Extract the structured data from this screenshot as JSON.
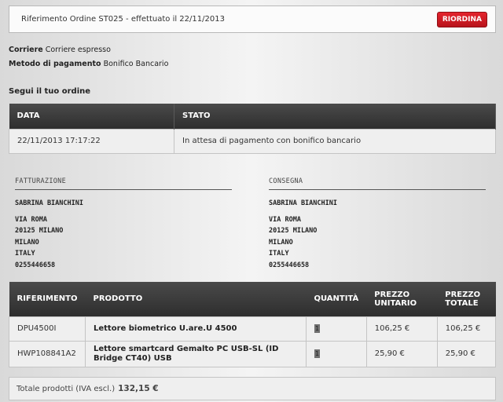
{
  "header": {
    "order_ref": "Riferimento Ordine ST025 - effettuato il 22/11/2013",
    "reorder_label": "RIORDINA",
    "accent_color": "#d71a22"
  },
  "info": {
    "carrier_label": "Corriere",
    "carrier_value": "Corriere espresso",
    "payment_label": "Metodo di pagamento",
    "payment_value": "Bonifico Bancario"
  },
  "tracking": {
    "title": "Segui il tuo ordine",
    "columns": [
      "DATA",
      "STATO"
    ],
    "rows": [
      {
        "date": "22/11/2013 17:17:22",
        "status": "In attesa di pagamento con bonifico bancario"
      }
    ]
  },
  "billing": {
    "title": "FATTURAZIONE",
    "name": "SABRINA BIANCHINI",
    "street": "VIA ROMA",
    "zip_city": "20125 MILANO",
    "city": "MILANO",
    "country": "ITALY",
    "phone": "0255446658"
  },
  "shipping": {
    "title": "CONSEGNA",
    "name": "SABRINA BIANCHINI",
    "street": "VIA ROMA",
    "zip_city": "20125 MILANO",
    "city": "MILANO",
    "country": "ITALY",
    "phone": "0255446658"
  },
  "items": {
    "columns": {
      "ref": "RIFERIMENTO",
      "product": "PRODOTTO",
      "qty": "QUANTITÀ",
      "unit_price_1": "PREZZO",
      "unit_price_2": "UNITARIO",
      "total_price_1": "PREZZO",
      "total_price_2": "TOTALE"
    },
    "rows": [
      {
        "ref": "DPU4500I",
        "product": "Lettore biometrico U.are.U 4500",
        "qty": "1",
        "unit_price": "106,25 €",
        "total_price": "106,25 €"
      },
      {
        "ref": "HWP108841A2",
        "product": "Lettore smartcard Gemalto PC USB-SL (ID Bridge CT40) USB",
        "qty": "1",
        "unit_price": "25,90 €",
        "total_price": "25,90 €"
      }
    ],
    "total_label": "Totale prodotti (IVA escl.)",
    "total_value": "132,15 €"
  }
}
